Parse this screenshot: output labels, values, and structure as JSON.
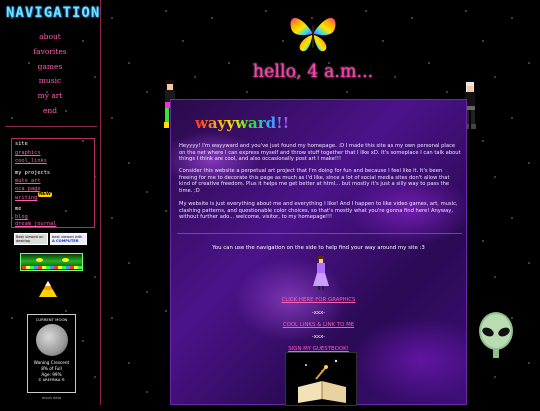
{
  "sidebar": {
    "title": "NAVIGATION",
    "links": [
      "about",
      "favorites",
      "games",
      "music",
      "my art",
      "end"
    ],
    "site_box": {
      "items": [
        "site",
        "graphics",
        "cool links",
        "my projects",
        "mute art",
        "oca page",
        "writing",
        "me",
        "blog",
        "dream journal"
      ],
      "new_badge": "NEW"
    },
    "badges": {
      "desktop": "Best viewed on desktop",
      "computer_prefix": "best viewed with",
      "computer_emph": "A COMPUTER"
    },
    "moon": {
      "title": "CURRENT MOON",
      "phase": "Waning Crescent",
      "percent": "8% of Full",
      "age": "Age: 99%",
      "credit": "© AREFRIKA ®",
      "footer": "moon data"
    }
  },
  "header": {
    "greeting": "hello, 4 a.m..."
  },
  "main": {
    "title": "wayyward!!",
    "paragraphs": [
      "Heyyyy! I'm wayyward and you've just found my homepage. :D I made this site as my own personal place on the net where I can express myself and throw stuff together that I like xD. It's someplace I can talk about things I think are cool, and also occasionally post art I make!!!",
      "Consider this website a perpetual art project that I'm doing for fun and because I feel like it. It's been freeing for me to decorate this page as much as I'd like, since a lot of social media sites don't allow that kind of creative freedom. Plus it helps me get better at html... but mostly it's just a silly way to pass the time. ;D",
      "My website is just everything about me and everything I like! And I happen to like video games, art, music, clashing patterns, and questionable color choices, so that's mostly what you're gonna find here! Anyway, without further ado... welcome, visitor, to my homepage!!!"
    ],
    "nav_hint": "You can use the navigation on the side to help find your way around my site :3",
    "link_graphics": "CLICK HERE FOR GRAPHICS",
    "sep1": "-xxx-",
    "link_cool": "COOL LINKS & LINK TO ME",
    "sep2": "-xxx-",
    "link_guestbook": "SIGN MY GUESTBOOK!"
  }
}
